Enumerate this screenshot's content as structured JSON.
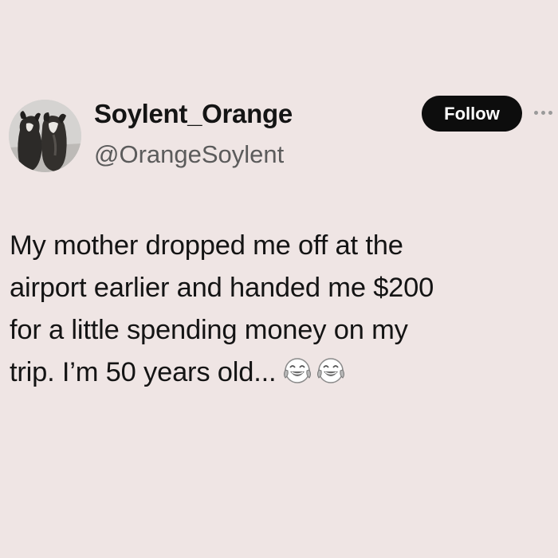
{
  "tweet": {
    "author": {
      "display_name": "Soylent_Orange",
      "handle": "@OrangeSoylent",
      "avatar": "two-dogs-avatar"
    },
    "follow_label": "Follow",
    "more_icon": "more-horizontal-icon",
    "text_lines": [
      "My mother dropped me off at the",
      "airport earlier and handed me $200",
      "for a little spending money on my",
      "trip. I’m 50 years old..."
    ],
    "emojis": [
      "face-with-tears-of-joy-icon",
      "face-with-tears-of-joy-icon"
    ]
  },
  "colors": {
    "background": "#efe5e4",
    "follow_button": "#0d0d0d",
    "text": "#141414",
    "handle": "#5b5b5b"
  }
}
